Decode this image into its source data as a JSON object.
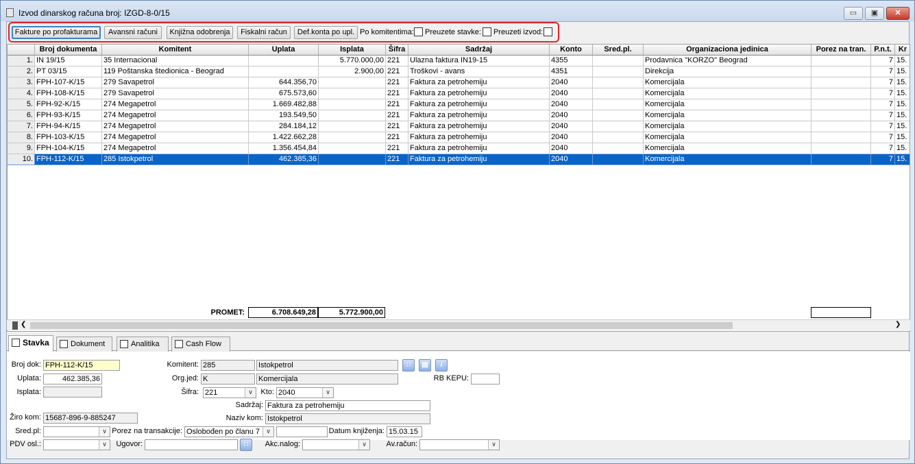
{
  "window": {
    "title": "Izvod dinarskog računa broj: IZGD-8-0/15",
    "minimize": "▭",
    "maximize": "▣",
    "close": "✕"
  },
  "toolbar": {
    "btn_profakture": "Fakture po profakturama",
    "btn_avansni": "Avansni računi",
    "btn_knjizna": "Knjižna odobrenja",
    "btn_fiskalni": "Fiskalni račun",
    "btn_defkonta": "Def.konta po upl.",
    "lbl_po_komitentima": "Po komitentima:",
    "lbl_preuzete_stavke": "Preuzete stavke:",
    "lbl_preuzeti_izvod": "Preuzeti izvod:"
  },
  "grid": {
    "columns": [
      "Broj dokumenta",
      "Komitent",
      "Uplata",
      "Isplata",
      "Šifra",
      "Sadržaj",
      "Konto",
      "Sred.pl.",
      "Organizaciona jedinica",
      "Porez na tran.",
      "P.n.t.",
      "Kr"
    ],
    "rows": [
      {
        "n": "1.",
        "doc": "IN 19/15",
        "kom": "35 Internacional",
        "upl": "",
        "ispl": "5.770.000,00",
        "sif": "221",
        "sad": "Ulazna faktura IN19-15",
        "kto": "4355",
        "sred": "",
        "org": "Prodavnica \"KORZO\" Beograd",
        "por": "",
        "pnt": "7",
        "kr": "15."
      },
      {
        "n": "2.",
        "doc": "PT 03/15",
        "kom": "119 Poštanska štedionica - Beograd",
        "upl": "",
        "ispl": "2.900,00",
        "sif": "221",
        "sad": "Troškovi - avans",
        "kto": "4351",
        "sred": "",
        "org": "Direkcija",
        "por": "",
        "pnt": "7",
        "kr": "15."
      },
      {
        "n": "3.",
        "doc": "FPH-107-K/15",
        "kom": "279 Savapetrol",
        "upl": "644.356,70",
        "ispl": "",
        "sif": "221",
        "sad": "Faktura za petrohemiju",
        "kto": "2040",
        "sred": "",
        "org": "Komercijala",
        "por": "",
        "pnt": "7",
        "kr": "15."
      },
      {
        "n": "4.",
        "doc": "FPH-108-K/15",
        "kom": "279 Savapetrol",
        "upl": "675.573,60",
        "ispl": "",
        "sif": "221",
        "sad": "Faktura za petrohemiju",
        "kto": "2040",
        "sred": "",
        "org": "Komercijala",
        "por": "",
        "pnt": "7",
        "kr": "15."
      },
      {
        "n": "5.",
        "doc": "FPH-92-K/15",
        "kom": "274 Megapetrol",
        "upl": "1.669.482,88",
        "ispl": "",
        "sif": "221",
        "sad": "Faktura za petrohemiju",
        "kto": "2040",
        "sred": "",
        "org": "Komercijala",
        "por": "",
        "pnt": "7",
        "kr": "15."
      },
      {
        "n": "6.",
        "doc": "FPH-93-K/15",
        "kom": "274 Megapetrol",
        "upl": "193.549,50",
        "ispl": "",
        "sif": "221",
        "sad": "Faktura za petrohemiju",
        "kto": "2040",
        "sred": "",
        "org": "Komercijala",
        "por": "",
        "pnt": "7",
        "kr": "15."
      },
      {
        "n": "7.",
        "doc": "FPH-94-K/15",
        "kom": "274 Megapetrol",
        "upl": "284.184,12",
        "ispl": "",
        "sif": "221",
        "sad": "Faktura za petrohemiju",
        "kto": "2040",
        "sred": "",
        "org": "Komercijala",
        "por": "",
        "pnt": "7",
        "kr": "15."
      },
      {
        "n": "8.",
        "doc": "FPH-103-K/15",
        "kom": "274 Megapetrol",
        "upl": "1.422.662,28",
        "ispl": "",
        "sif": "221",
        "sad": "Faktura za petrohemiju",
        "kto": "2040",
        "sred": "",
        "org": "Komercijala",
        "por": "",
        "pnt": "7",
        "kr": "15."
      },
      {
        "n": "9.",
        "doc": "FPH-104-K/15",
        "kom": "274 Megapetrol",
        "upl": "1.356.454,84",
        "ispl": "",
        "sif": "221",
        "sad": "Faktura za petrohemiju",
        "kto": "2040",
        "sred": "",
        "org": "Komercijala",
        "por": "",
        "pnt": "7",
        "kr": "15."
      },
      {
        "n": "10.",
        "doc": "FPH-112-K/15",
        "kom": "285 Istokpetrol",
        "upl": "462.385,36",
        "ispl": "",
        "sif": "221",
        "sad": "Faktura za petrohemiju",
        "kto": "2040",
        "sred": "",
        "org": "Komercijala",
        "por": "",
        "pnt": "7",
        "kr": "15."
      }
    ],
    "selected_row": 9,
    "totals": {
      "label": "PROMET:",
      "uplata": "6.708.649,28",
      "isplata": "5.772.900,00"
    }
  },
  "tabs": [
    "Stavka",
    "Dokument",
    "Analitika",
    "Cash Flow"
  ],
  "detail": {
    "lbl_broj_dok": "Broj dok:",
    "broj_dok": "FPH-112-K/15",
    "lbl_uplata": "Uplata:",
    "uplata": "462.385,36",
    "lbl_isplata": "Isplata:",
    "isplata": "",
    "lbl_ziro": "Žiro kom:",
    "ziro": "15687-896-9-885247",
    "lbl_komitent": "Komitent:",
    "komitent_id": "285",
    "komitent_naziv": "Istokpetrol",
    "lbl_orgjed": "Org.jed:",
    "orgjed_id": "K",
    "orgjed_naziv": "Komercijala",
    "lbl_sifra": "Šifra:",
    "sifra": "221",
    "lbl_kto": "Kto:",
    "kto": "2040",
    "lbl_sadrzaj": "Sadržaj:",
    "sadrzaj": "Faktura za petrohemiju",
    "lbl_naziv_kom": "Naziv kom:",
    "naziv_kom": "Istokpetrol",
    "lbl_rb_kepu": "RB KEPU:",
    "rb_kepu": "",
    "lbl_sredpl": "Sred.pl:",
    "sredpl": "",
    "lbl_porez": "Porez na transakcije:",
    "porez": "Oslobođen po članu 7",
    "porez_extra": "",
    "lbl_datum": "Datum knjiženja:",
    "datum": "15.03.15",
    "lbl_pdv": "PDV osl.:",
    "pdv": "",
    "lbl_ugovor": "Ugovor:",
    "ugovor": "",
    "lbl_akc": "Akc.nalog:",
    "akc": "",
    "lbl_avracun": "Av.račun:",
    "avracun": ""
  }
}
